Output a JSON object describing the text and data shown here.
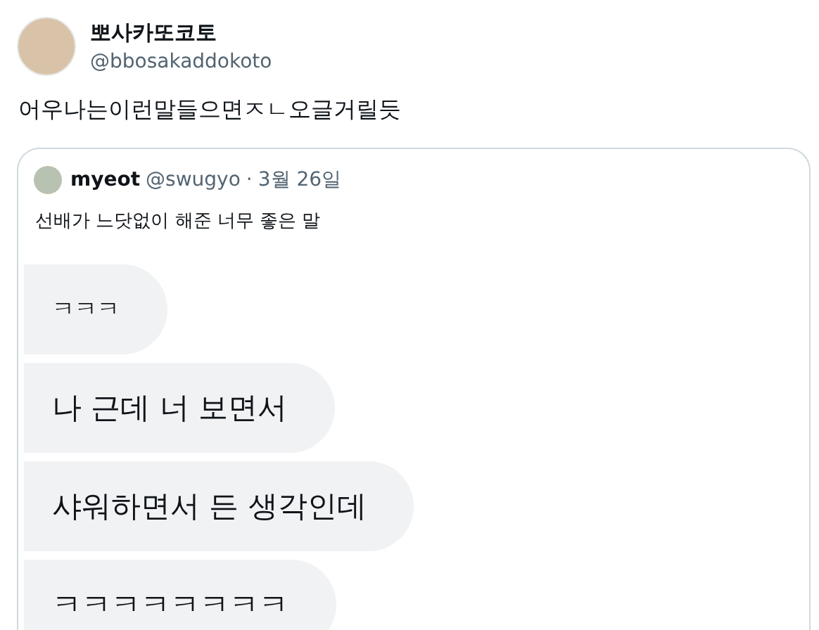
{
  "tweet": {
    "display_name": "뽀사카또코토",
    "handle": "@bbosakaddokoto",
    "text": "어우나는이런말들으면ㅈㄴ오글거릴듯"
  },
  "quote": {
    "display_name": "myeot",
    "handle": "@swugyo",
    "separator": "·",
    "date": "3월 26일",
    "text": "선배가 느닷없이 해준 너무 좋은 말",
    "messages": [
      {
        "text": "ㅋㅋㅋ"
      },
      {
        "text": "나 근데 너 보면서"
      },
      {
        "text": "샤워하면서 든 생각인데"
      },
      {
        "text": "ㅋㅋㅋㅋㅋㅋㅋㅋ"
      }
    ]
  }
}
